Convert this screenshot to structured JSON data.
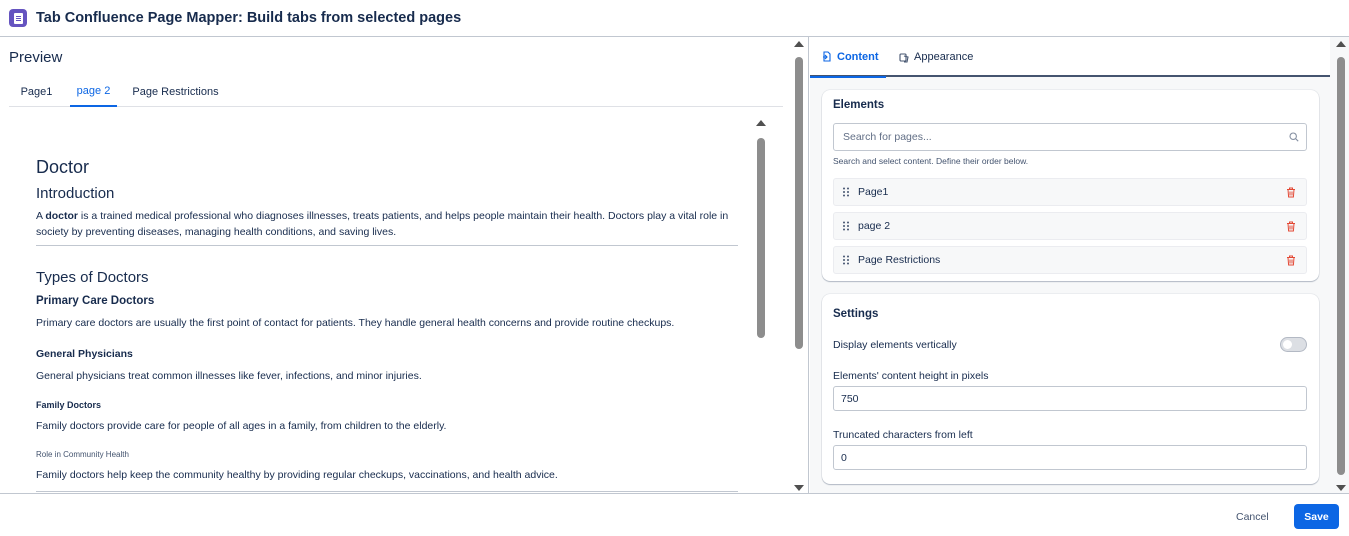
{
  "header": {
    "title": "Tab Confluence Page Mapper: Build tabs from selected pages"
  },
  "preview": {
    "title": "Preview",
    "tabs": [
      {
        "label": "Page1"
      },
      {
        "label": "page 2"
      },
      {
        "label": "Page Restrictions"
      }
    ],
    "active_tab": "page 2",
    "document": {
      "title": "Doctor",
      "intro_heading": "Introduction",
      "intro_prefix": "A ",
      "intro_bold": "doctor",
      "intro_text": " is a trained medical professional who diagnoses illnesses, treats patients, and helps people maintain their health. Doctors play a vital role in society by preventing diseases, managing health conditions, and saving lives.",
      "types_heading": "Types of Doctors",
      "primary_heading": "Primary Care Doctors",
      "primary_text": "Primary care doctors are usually the first point of contact for patients. They handle general health concerns and provide routine checkups.",
      "gp_heading": "General Physicians",
      "gp_text": "General physicians treat common illnesses like fever, infections, and minor injuries.",
      "family_heading": "Family Doctors",
      "family_text": "Family doctors provide care for people of all ages in a family, from children to the elderly.",
      "role_heading": "Role in Community Health",
      "role_text": "Family doctors help keep the community healthy by providing regular checkups, vaccinations, and health advice."
    }
  },
  "config": {
    "tabs": {
      "content": "Content",
      "appearance": "Appearance"
    },
    "active_tab": "Content",
    "elements": {
      "title": "Elements",
      "search_placeholder": "Search for pages...",
      "helper": "Search and select content. Define their order below.",
      "items": [
        {
          "label": "Page1"
        },
        {
          "label": "page 2"
        },
        {
          "label": "Page Restrictions"
        }
      ]
    },
    "settings": {
      "title": "Settings",
      "display_vertically_label": "Display elements vertically",
      "display_vertically": false,
      "height_label": "Elements' content height in pixels",
      "height_value": "750",
      "truncate_label": "Truncated characters from left",
      "truncate_value": "0"
    }
  },
  "footer": {
    "cancel_label": "Cancel",
    "save_label": "Save"
  },
  "colors": {
    "accent": "#0c66e4",
    "danger": "#e34935",
    "app_icon": "#6554c0",
    "text": "#172b4d"
  }
}
